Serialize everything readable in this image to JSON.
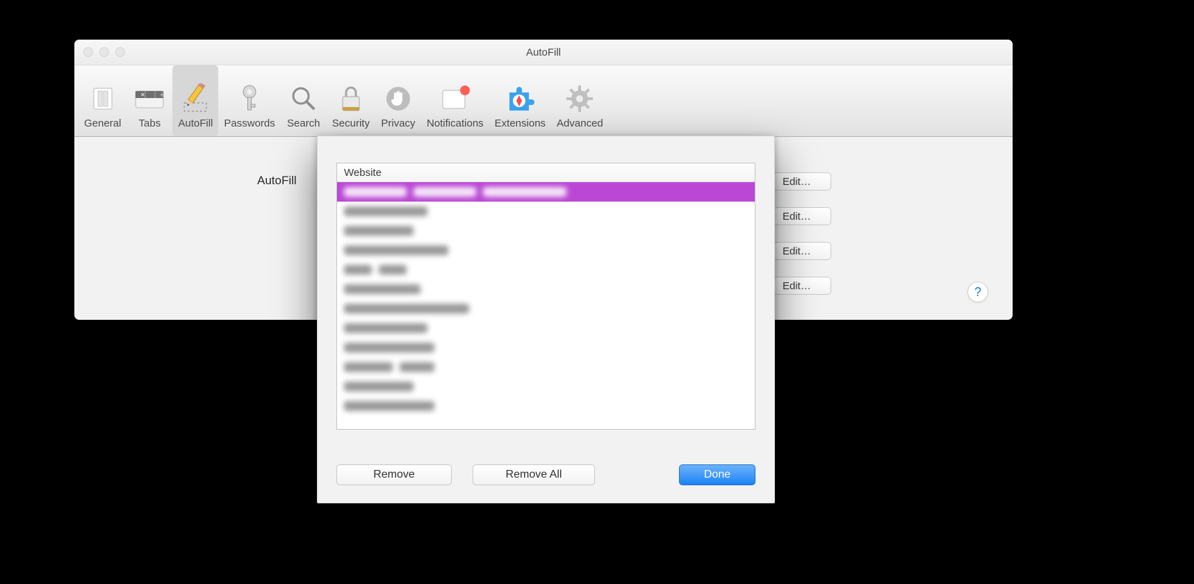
{
  "window": {
    "title": "AutoFill"
  },
  "toolbar": {
    "items": [
      {
        "id": "general",
        "label": "General"
      },
      {
        "id": "tabs",
        "label": "Tabs"
      },
      {
        "id": "autofill",
        "label": "AutoFill",
        "selected": true
      },
      {
        "id": "passwords",
        "label": "Passwords"
      },
      {
        "id": "search",
        "label": "Search"
      },
      {
        "id": "security",
        "label": "Security"
      },
      {
        "id": "privacy",
        "label": "Privacy"
      },
      {
        "id": "notifications",
        "label": "Notifications"
      },
      {
        "id": "extensions",
        "label": "Extensions"
      },
      {
        "id": "advanced",
        "label": "Advanced"
      }
    ]
  },
  "content": {
    "section_label": "AutoFill",
    "edit_label": "Edit…",
    "edit_count": 4
  },
  "help": {
    "glyph": "?"
  },
  "sheet": {
    "header": "Website",
    "rows": [
      {
        "selected": true,
        "segments": [
          90,
          90,
          120
        ]
      },
      {
        "selected": false,
        "segments": [
          120
        ]
      },
      {
        "selected": false,
        "segments": [
          100
        ]
      },
      {
        "selected": false,
        "segments": [
          150
        ]
      },
      {
        "selected": false,
        "segments": [
          40,
          40
        ]
      },
      {
        "selected": false,
        "segments": [
          110
        ]
      },
      {
        "selected": false,
        "segments": [
          180
        ]
      },
      {
        "selected": false,
        "segments": [
          120
        ]
      },
      {
        "selected": false,
        "segments": [
          130
        ]
      },
      {
        "selected": false,
        "segments": [
          70,
          50
        ]
      },
      {
        "selected": false,
        "segments": [
          100
        ]
      },
      {
        "selected": false,
        "segments": [
          130
        ]
      }
    ],
    "buttons": {
      "remove": "Remove",
      "remove_all": "Remove All",
      "done": "Done"
    }
  }
}
